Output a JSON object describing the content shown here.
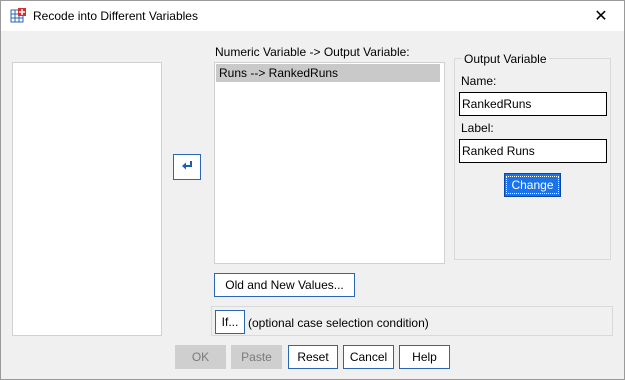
{
  "window": {
    "title": "Recode into Different Variables"
  },
  "mapping": {
    "header": "Numeric Variable -> Output Variable:",
    "items": [
      "Runs --> RankedRuns"
    ]
  },
  "output": {
    "group_title": "Output Variable",
    "name_label": "Name:",
    "name_value": "RankedRuns",
    "label_label": "Label:",
    "label_value": "Ranked Runs",
    "change_button": "Change"
  },
  "buttons": {
    "old_new": "Old and New Values...",
    "if": "If...",
    "if_hint": "(optional case selection condition)",
    "ok": "OK",
    "paste": "Paste",
    "reset": "Reset",
    "cancel": "Cancel",
    "help": "Help"
  },
  "icons": {
    "app": "spss-dialog-icon",
    "close": "close-icon",
    "move": "move-back-arrow-icon"
  },
  "colors": {
    "accent": "#1a73e8",
    "selection": "#c9c9c9",
    "button_border": "#2b66b1"
  }
}
